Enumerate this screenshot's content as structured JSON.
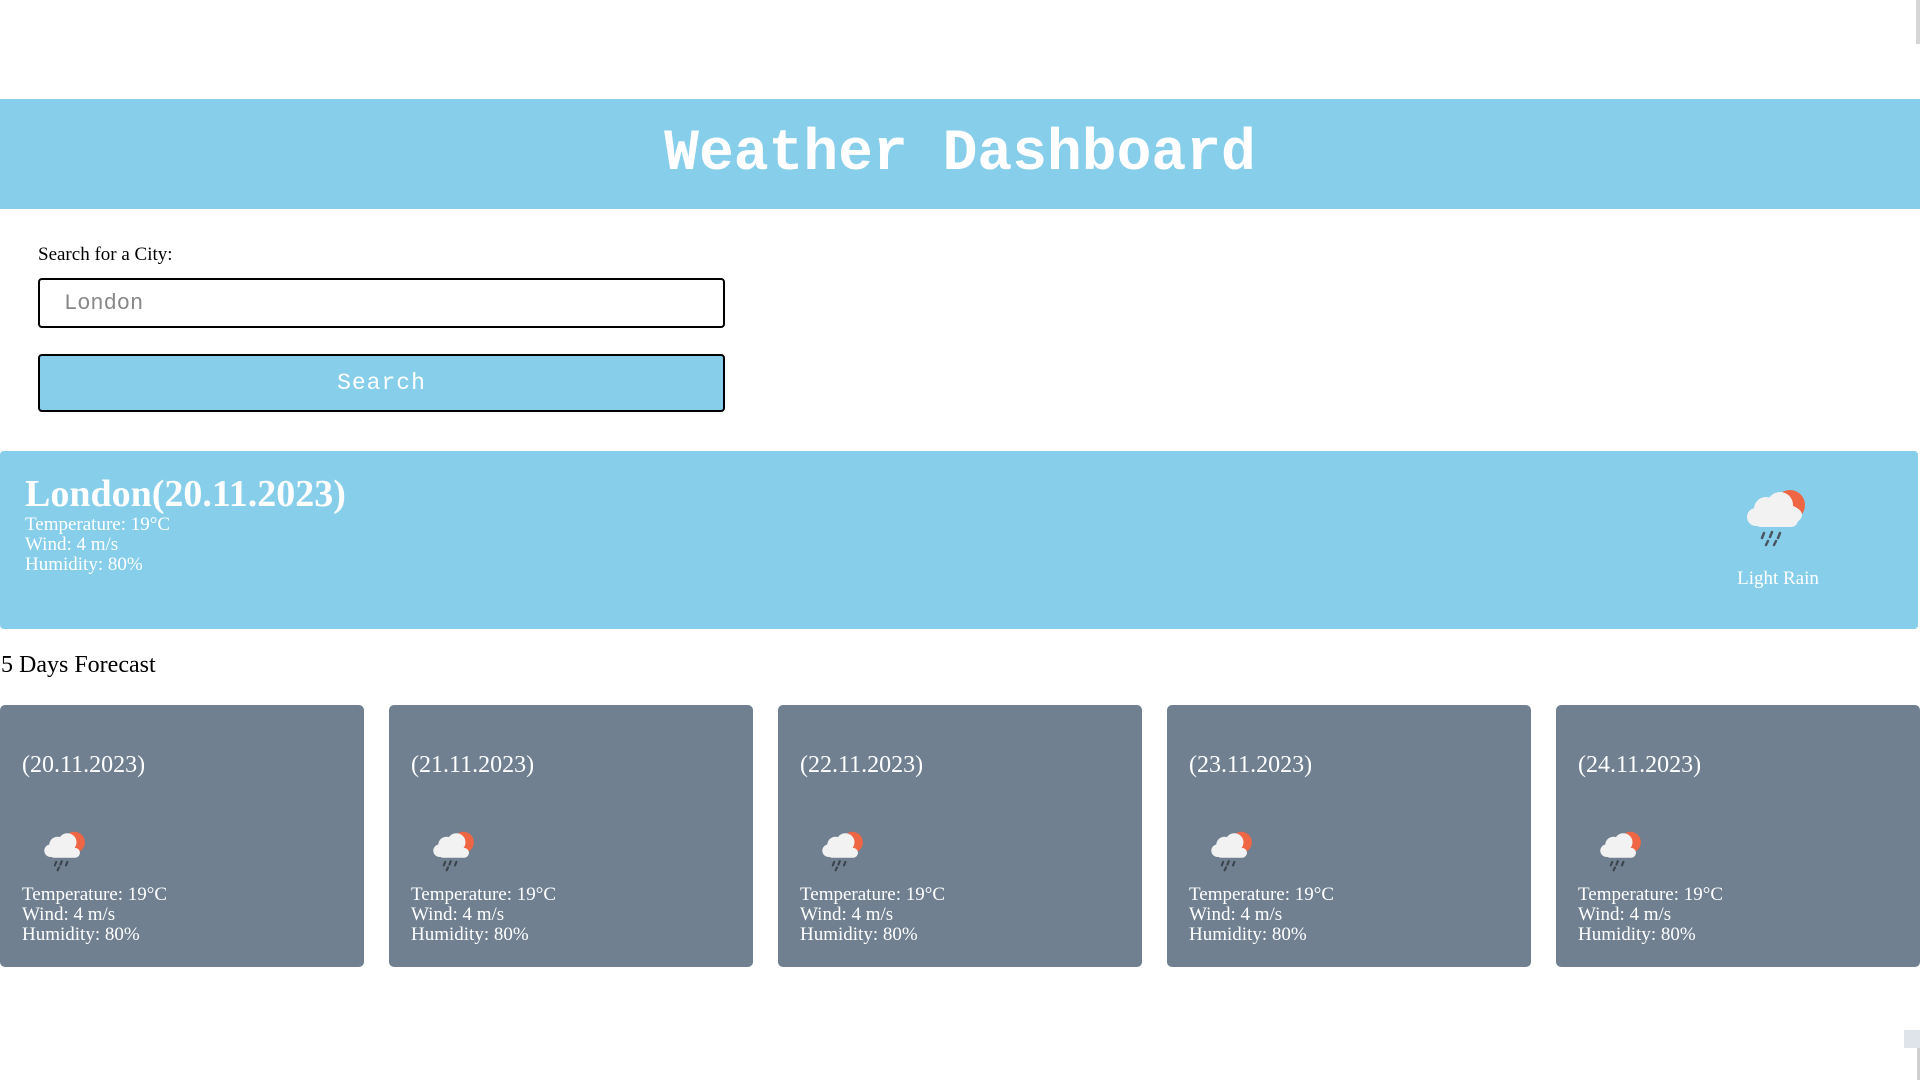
{
  "header": {
    "title": "Weather Dashboard"
  },
  "search": {
    "label": "Search for a City:",
    "placeholder": "London",
    "value": "",
    "button_label": "Search"
  },
  "current": {
    "title": "London(20.11.2023)",
    "temperature": "Temperature: 19°C",
    "wind": "Wind: 4 m/s",
    "humidity": "Humidity: 80%",
    "condition": "Light Rain",
    "icon": "rain-cloud-sun-icon"
  },
  "forecast": {
    "heading": "5 Days Forecast",
    "days": [
      {
        "date": "(20.11.2023)",
        "temperature": "Temperature: 19°C",
        "wind": "Wind: 4 m/s",
        "humidity": "Humidity: 80%",
        "icon": "rain-cloud-sun-icon"
      },
      {
        "date": "(21.11.2023)",
        "temperature": "Temperature: 19°C",
        "wind": "Wind: 4 m/s",
        "humidity": "Humidity: 80%",
        "icon": "rain-cloud-sun-icon"
      },
      {
        "date": "(22.11.2023)",
        "temperature": "Temperature: 19°C",
        "wind": "Wind: 4 m/s",
        "humidity": "Humidity: 80%",
        "icon": "rain-cloud-sun-icon"
      },
      {
        "date": "(23.11.2023)",
        "temperature": "Temperature: 19°C",
        "wind": "Wind: 4 m/s",
        "humidity": "Humidity: 80%",
        "icon": "rain-cloud-sun-icon"
      },
      {
        "date": "(24.11.2023)",
        "temperature": "Temperature: 19°C",
        "wind": "Wind: 4 m/s",
        "humidity": "Humidity: 80%",
        "icon": "rain-cloud-sun-icon"
      }
    ]
  },
  "colors": {
    "header_bg": "#87CEEB",
    "card_bg": "#708090",
    "sun": "#EE6644"
  }
}
